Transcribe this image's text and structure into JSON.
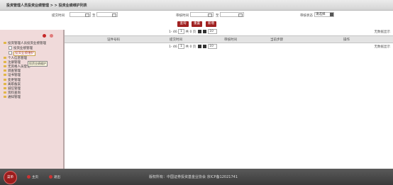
{
  "header": {
    "title": "投资管理人员投资业绩管理 > > 投资业绩维护列表"
  },
  "search": {
    "submit_time_label": "提交时间",
    "review_time_label": "审核时间",
    "to_label": "至",
    "review_status_label": "审核状态",
    "review_status_value": "请选择"
  },
  "actions": {
    "query": "查询",
    "reset": "重置",
    "add": "新增"
  },
  "pager": {
    "range": "1- 46",
    "page": "1",
    "total_pages": "共 0 页",
    "page_size": "10"
  },
  "no_data": "无数据显示",
  "table": {
    "columns": [
      "证件号码",
      "提交时间",
      "审核时间",
      "当前步骤",
      "操作"
    ]
  },
  "sidebar": {
    "tree": [
      {
        "label": "投资管理人员投资业绩管理",
        "level": 0
      },
      {
        "label": "投资业绩管理",
        "level": 1
      },
      {
        "label": "投资业绩维护",
        "level": 1,
        "selected": true
      },
      {
        "label": "个人信息管理",
        "level": 0
      },
      {
        "label": "注册管理",
        "level": 0
      },
      {
        "label": "无资格人员登记",
        "level": 0
      },
      {
        "label": "调查管理",
        "level": 0
      },
      {
        "label": "证书管理",
        "level": 0
      },
      {
        "label": "变更管理",
        "level": 0
      },
      {
        "label": "离职备案",
        "level": 0
      },
      {
        "label": "诚信管理",
        "level": 0
      },
      {
        "label": "资料查询",
        "level": 0
      },
      {
        "label": "通知管理",
        "level": 0
      }
    ],
    "tooltip": "投资业绩维护"
  },
  "footer": {
    "menu_label": "菜单",
    "home": "主页",
    "logout": "退出",
    "copyright": "版权所有：中国证券投资基金业协会 京ICP备12021741"
  }
}
